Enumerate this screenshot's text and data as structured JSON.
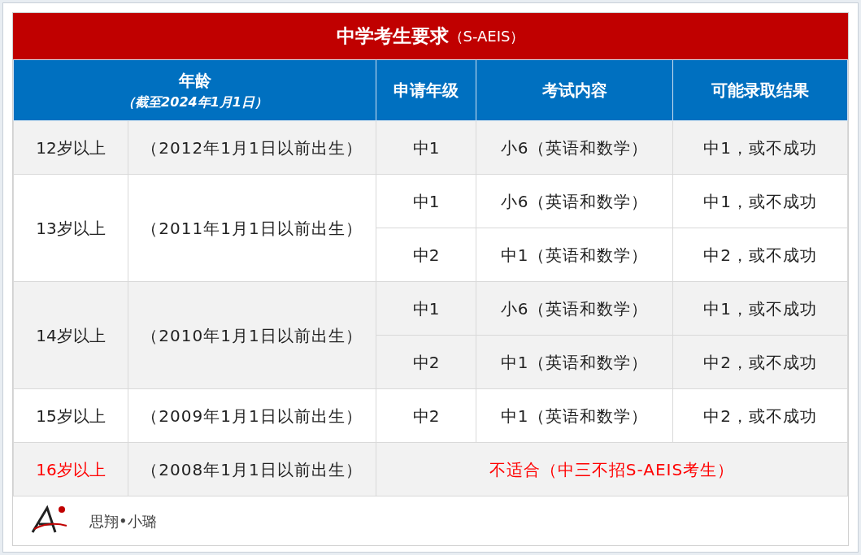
{
  "title": "中学考生要求",
  "title_suffix": "（S-AEIS）",
  "header": {
    "age": "年龄",
    "age_note": "（截至2024年1月1日）",
    "columns": [
      "申请年级",
      "考试内容",
      "可能录取结果"
    ]
  },
  "groups": [
    {
      "kind": "rows",
      "age": "12岁以上",
      "birth": "（2012年1月1日以前出生）",
      "highlight": false,
      "rows": [
        {
          "grade": "中1",
          "exam": "小6（英语和数学）",
          "result": "中1，或不成功"
        }
      ]
    },
    {
      "kind": "rows",
      "age": "13岁以上",
      "birth": "（2011年1月1日以前出生）",
      "highlight": false,
      "rows": [
        {
          "grade": "中1",
          "exam": "小6（英语和数学）",
          "result": "中1，或不成功"
        },
        {
          "grade": "中2",
          "exam": "中1（英语和数学）",
          "result": "中2，或不成功"
        }
      ]
    },
    {
      "kind": "rows",
      "age": "14岁以上",
      "birth": "（2010年1月1日以前出生）",
      "highlight": false,
      "rows": [
        {
          "grade": "中1",
          "exam": "小6（英语和数学）",
          "result": "中1，或不成功"
        },
        {
          "grade": "中2",
          "exam": "中1（英语和数学）",
          "result": "中2，或不成功"
        }
      ]
    },
    {
      "kind": "rows",
      "age": "15岁以上",
      "birth": "（2009年1月1日以前出生）",
      "highlight": false,
      "rows": [
        {
          "grade": "中2",
          "exam": "中1（英语和数学）",
          "result": "中2，或不成功"
        }
      ]
    },
    {
      "kind": "note",
      "age": "16岁以上",
      "birth": "（2008年1月1日以前出生）",
      "highlight": true,
      "note": "不适合（中三不招S-AEIS考生）"
    }
  ],
  "footer": {
    "author": "思翔•小璐"
  }
}
